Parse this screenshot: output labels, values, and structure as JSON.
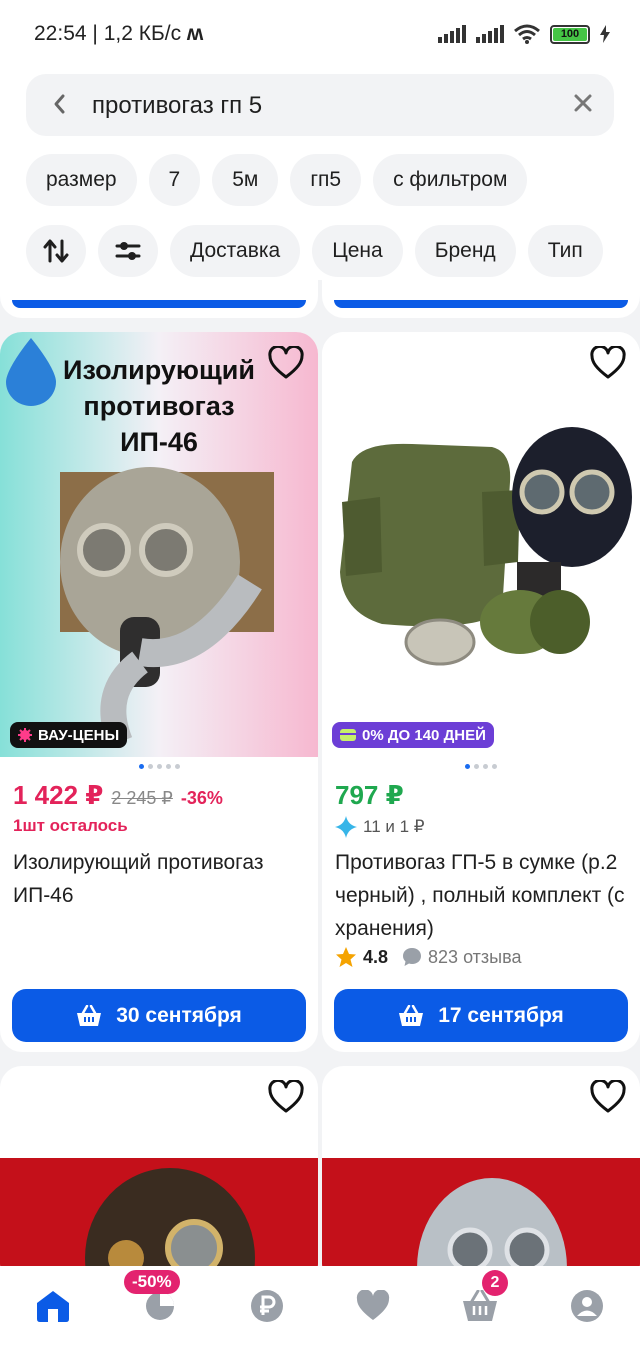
{
  "status": {
    "time": "22:54",
    "speed": "1,2 КБ/с",
    "battery": "100"
  },
  "search": {
    "query": "противогаз гп 5"
  },
  "chips": [
    "размер",
    "7",
    "5м",
    "гп5",
    "с фильтром"
  ],
  "filters": [
    "Доставка",
    "Цена",
    "Бренд",
    "Тип"
  ],
  "products": [
    {
      "image_caption": "Изолирующий противогаз ИП-46",
      "badge": "ВАУ-ЦЕНЫ",
      "badge_color": "#111111",
      "price": "1 422 ₽",
      "old_price": "2 245 ₽",
      "discount": "-36%",
      "price_color": "#e3235a",
      "stock": "1шт осталось",
      "title": "Изолирующий противогаз ИП-46",
      "button": "30 сентября"
    },
    {
      "badge": "0% ДО 140 ДНЕЙ",
      "badge_color": "#6c3ed6",
      "price": "797 ₽",
      "price_color": "#1fa84f",
      "bonus": "11 и 1 ₽",
      "title": "Противогаз ГП-5 в сумке (р.2 черный) , полный комплект (с хранения)",
      "rating": "4.8",
      "reviews": "823 отзыва",
      "button": "17 сентября"
    }
  ],
  "tabbar": {
    "promo": "-50%",
    "cart_count": "2"
  },
  "colors": {
    "accent": "#0b5be6",
    "promo": "#e3236f"
  }
}
